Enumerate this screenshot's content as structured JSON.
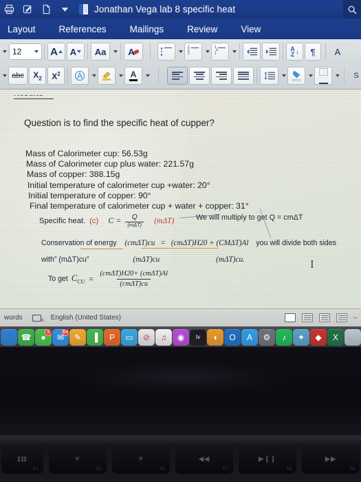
{
  "titlebar": {
    "doc_title": "Jonathan Vega lab 8 specific heat",
    "icons": [
      "print-icon",
      "markup-icon",
      "new-document-icon",
      "dropdown-icon",
      "word-file-icon"
    ],
    "search_icon": "search-icon"
  },
  "ribbon_tabs": [
    {
      "label": "Layout"
    },
    {
      "label": "References"
    },
    {
      "label": "Mailings"
    },
    {
      "label": "Review"
    },
    {
      "label": "View"
    }
  ],
  "ribbon": {
    "font_size": "12",
    "row1_buttons": [
      "grow-font-button",
      "shrink-font-button",
      "change-case-button",
      "clear-formatting-button",
      "bullet-list-button",
      "numbered-list-button",
      "multilevel-list-button",
      "decrease-indent-button",
      "increase-indent-button",
      "sort-button",
      "show-marks-button"
    ],
    "row2_buttons": [
      "strikethrough-button",
      "subscript-button",
      "superscript-button",
      "text-effects-button",
      "highlight-color-button",
      "font-color-button",
      "align-left-button",
      "align-center-button",
      "align-right-button",
      "justify-button",
      "line-spacing-button",
      "shading-button",
      "borders-button"
    ],
    "sort_label_top": "A",
    "sort_label_bottom": "Z",
    "pilcrow": "¶",
    "strike_label": "abc",
    "sub_label": "X",
    "sub_index": "2",
    "sup_label": "X",
    "sup_index": "2",
    "case_label": "Aa",
    "font_color_label": "A",
    "text_effect_label": "A",
    "highlight_label": "A",
    "big_a": "A",
    "med_a": "A"
  },
  "document": {
    "section_heading": "Results",
    "question": "Question is to find the specific heat of cupper?",
    "measurements": [
      "Mass of Calorimeter cup:  56.53g",
      "Mass of Calorimeter cup plus water: 221.57g",
      "Mass of copper: 388.15g",
      "Initial temperature of calorimeter cup +water: 20°",
      "Initial temperature of copper: 90°",
      "Final temperature of calorimeter cup + water + copper: 31°"
    ],
    "equations": {
      "line1_label": "Specific heat.",
      "line1_red_c": "(c)",
      "line1_cequals": "C =",
      "line1_frac_num": "Q",
      "line1_frac_den": "(mΔT)",
      "line1_red_mdt": "(mΔT)",
      "line1_note": "We will multiply to get Q = cmΔT",
      "line2_label": "Conservation of energy",
      "line2_lhs": "(cmΔT)cu",
      "line2_eq": "=",
      "line2_rhs": "(cmΔT)H20 + (CMΔT)Al",
      "line2_note": "you will divide both sides",
      "line3_label": "with” (mΔT)cu”",
      "line3_mid": "(mΔT)cu",
      "line3_right": "(mΔT)cu.",
      "line4_label": "To get",
      "line4_var": "C",
      "line4_var_sub": "CU",
      "line4_eq": "=",
      "line4_num": "(cmΔT)H20+  (cmΔT)Al",
      "line4_den": "(cmΔT)cu"
    },
    "cursor": "I"
  },
  "statusbar": {
    "words_label": "words",
    "proofing_icon": "proofing-language-icon",
    "language": "English (United States)",
    "view_buttons": [
      "print-layout-view",
      "web-layout-view",
      "outline-view",
      "draft-view"
    ],
    "zoom_minus": "−"
  },
  "dock": {
    "items": [
      {
        "name": "finder-icon",
        "glyph": "",
        "color": "#2f7fd1",
        "badge": ""
      },
      {
        "name": "facetime-icon",
        "glyph": "☎",
        "color": "#3cb24a",
        "badge": ""
      },
      {
        "name": "messages-icon",
        "glyph": "●",
        "color": "#49c24e",
        "badge": "5"
      },
      {
        "name": "mail-icon",
        "glyph": "✉",
        "color": "#2f8fe0",
        "badge": "64"
      },
      {
        "name": "pages-icon",
        "glyph": "✎",
        "color": "#f0a92e",
        "badge": ""
      },
      {
        "name": "numbers-icon",
        "glyph": "▐",
        "color": "#43b94b",
        "badge": ""
      },
      {
        "name": "keynote-icon",
        "glyph": "P",
        "color": "#e8662a",
        "badge": ""
      },
      {
        "name": "presentation-icon",
        "glyph": "▭",
        "color": "#36a7e0",
        "badge": ""
      },
      {
        "name": "no-entry-icon",
        "glyph": "⊘",
        "color": "#e8e8ea",
        "badge": ""
      },
      {
        "name": "music-icon",
        "glyph": "♫",
        "color": "#f2f2f4",
        "badge": ""
      },
      {
        "name": "podcasts-icon",
        "glyph": "◉",
        "color": "#b84ad6",
        "badge": ""
      },
      {
        "name": "appletv-icon",
        "glyph": "tv",
        "color": "#1a1a1e",
        "badge": ""
      },
      {
        "name": "books-icon",
        "glyph": "◖",
        "color": "#e89a2c",
        "badge": ""
      },
      {
        "name": "outlook-icon",
        "glyph": "O",
        "color": "#1f6fc4",
        "badge": ""
      },
      {
        "name": "app-store-icon",
        "glyph": "A",
        "color": "#2f9de8",
        "badge": ""
      },
      {
        "name": "settings-icon",
        "glyph": "⚙",
        "color": "#6e7278",
        "badge": ""
      },
      {
        "name": "spotify-icon",
        "glyph": "♪",
        "color": "#1db954",
        "badge": ""
      },
      {
        "name": "photos-icon",
        "glyph": "✦",
        "color": "#5aa0c9",
        "badge": ""
      },
      {
        "name": "bin-icon",
        "glyph": "◆",
        "color": "#c9302c",
        "badge": ""
      },
      {
        "name": "excel-icon",
        "glyph": "X",
        "color": "#1d7044",
        "badge": ""
      },
      {
        "name": "finder-window-icon",
        "glyph": "",
        "color": "#b9c4cc",
        "badge": ""
      },
      {
        "name": "trash-icon",
        "glyph": "○",
        "color": "#4a4e55",
        "badge": ""
      }
    ]
  },
  "keyboard": {
    "keys": [
      {
        "name": "key-f4",
        "glyph": "dots",
        "fn": "F4"
      },
      {
        "name": "key-f5",
        "glyph": "☀",
        "fn": "F5"
      },
      {
        "name": "key-f6",
        "glyph": "☀",
        "fn": "F6"
      },
      {
        "name": "key-f7-rewind",
        "glyph": "◀◀",
        "fn": "F7"
      },
      {
        "name": "key-f8-playpause",
        "glyph": "▶❙❙",
        "fn": "F8"
      },
      {
        "name": "key-f9-forward",
        "glyph": "▶▶",
        "fn": "F9"
      }
    ]
  }
}
